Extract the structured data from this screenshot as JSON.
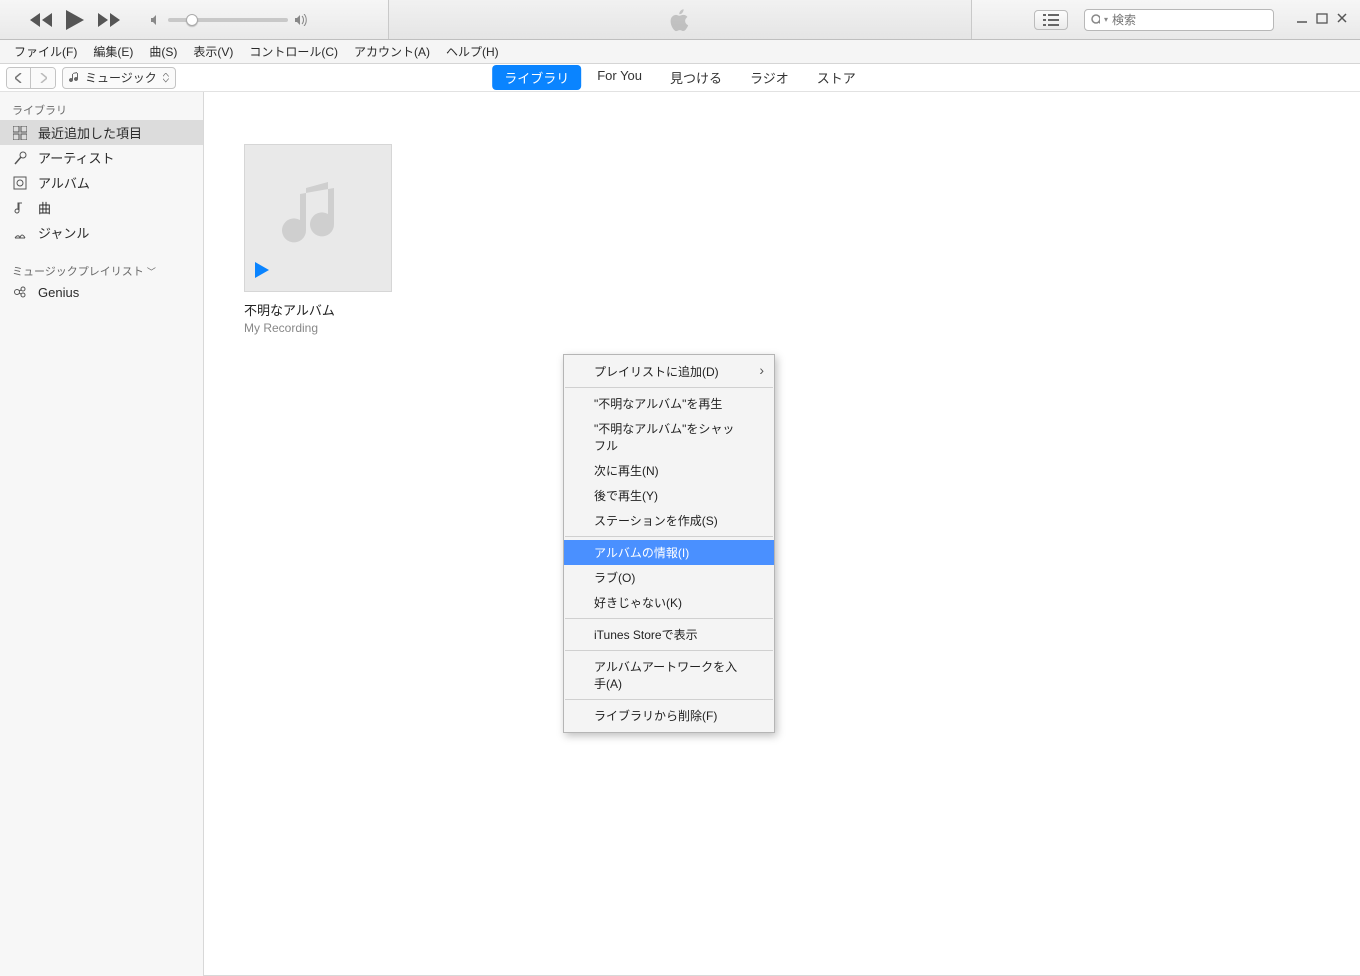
{
  "search": {
    "placeholder": "検索"
  },
  "menubar": [
    "ファイル(F)",
    "編集(E)",
    "曲(S)",
    "表示(V)",
    "コントロール(C)",
    "アカウント(A)",
    "ヘルプ(H)"
  ],
  "mediaSelect": "ミュージック",
  "tabs": [
    {
      "label": "ライブラリ",
      "active": true
    },
    {
      "label": "For You"
    },
    {
      "label": "見つける"
    },
    {
      "label": "ラジオ"
    },
    {
      "label": "ストア"
    }
  ],
  "sidebar": {
    "libraryHeader": "ライブラリ",
    "items": [
      {
        "label": "最近追加した項目",
        "selected": true,
        "icon": "grid"
      },
      {
        "label": "アーティスト",
        "icon": "mic"
      },
      {
        "label": "アルバム",
        "icon": "album"
      },
      {
        "label": "曲",
        "icon": "note"
      },
      {
        "label": "ジャンル",
        "icon": "genre"
      }
    ],
    "playlistsHeader": "ミュージックプレイリスト",
    "playlists": [
      {
        "label": "Genius",
        "icon": "genius"
      }
    ]
  },
  "album": {
    "title": "不明なアルバム",
    "artist": "My Recording"
  },
  "contextMenu": [
    {
      "label": "プレイリストに追加(D)",
      "sub": true
    },
    {
      "sep": true
    },
    {
      "label": "\"不明なアルバム\"を再生"
    },
    {
      "label": "\"不明なアルバム\"をシャッフル"
    },
    {
      "label": "次に再生(N)"
    },
    {
      "label": "後で再生(Y)"
    },
    {
      "label": "ステーションを作成(S)"
    },
    {
      "sep": true
    },
    {
      "label": "アルバムの情報(I)",
      "hl": true
    },
    {
      "label": "ラブ(O)"
    },
    {
      "label": "好きじゃない(K)"
    },
    {
      "sep": true
    },
    {
      "label": "iTunes Storeで表示"
    },
    {
      "sep": true
    },
    {
      "label": "アルバムアートワークを入手(A)"
    },
    {
      "sep": true
    },
    {
      "label": "ライブラリから削除(F)"
    }
  ]
}
